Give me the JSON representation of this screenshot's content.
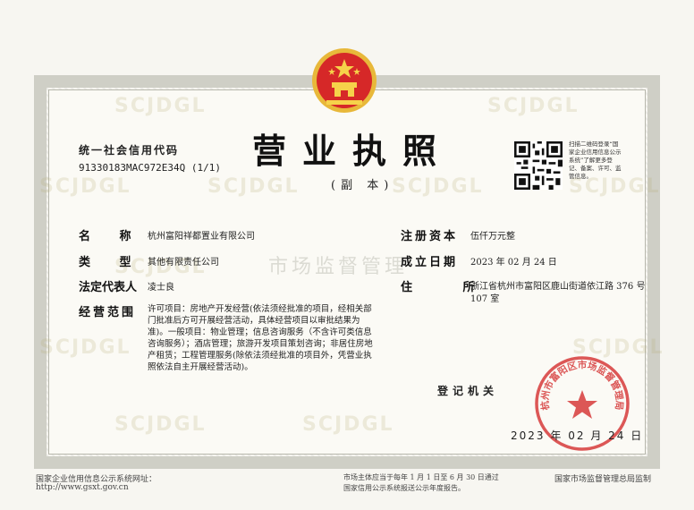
{
  "document": {
    "title": "营业执照",
    "subtitle": "(副 本)",
    "credit_code_label": "统一社会信用代码",
    "credit_code": "91330183MAC972E34Q (1/1)",
    "qr_note": "扫描二维码登录“国家企业信用信息公示系统”了解更多登记、备案、许可、监管信息。",
    "watermark": "SCJDGL",
    "faint_stamp": "市场监督管理",
    "registrar": "登记机关",
    "date": {
      "year": "2023",
      "year_mark": "年",
      "month": "02",
      "month_mark": "月",
      "day": "24",
      "day_mark": "日"
    }
  },
  "fields": {
    "name_label": "名 称",
    "name": "杭州富阳祥都置业有限公司",
    "type_label": "类 型",
    "type": "其他有限责任公司",
    "rep_label": "法定代表人",
    "rep": "凌士良",
    "scope_label": "经营范围",
    "scope": "许可项目：房地产开发经营(依法须经批准的项目，经相关部门批准后方可开展经营活动，具体经营项目以审批结果为准)。一般项目：物业管理；信息咨询服务（不含许可类信息咨询服务）；酒店管理；旅游开发项目策划咨询；非居住房地产租赁；工程管理服务(除依法须经批准的项目外，凭营业执照依法自主开展经营活动)。",
    "capital_label": "注册资本",
    "capital": "伍仟万元整",
    "est_label": "成立日期",
    "est": "2023 年 02 月 24 日",
    "address_label": "住 所",
    "address": "浙江省杭州市富阳区鹿山街道依江路 376 号107 室"
  },
  "seal": {
    "text": "杭州市富阳区市场监督管理局"
  },
  "footer": {
    "left": "国家企业信用信息公示系统网址：",
    "url": "http://www.gsxt.gov.cn",
    "middle1": "市场主体应当于每年 1 月 1 日至 6 月 30 日通过",
    "middle2": "国家信用公示系统报送公示年度报告。",
    "right": "国家市场监督管理总局监制"
  },
  "colors": {
    "emblem_red": "#d62828",
    "emblem_gold": "#e8b83a",
    "seal_red": "#d63a3a"
  }
}
